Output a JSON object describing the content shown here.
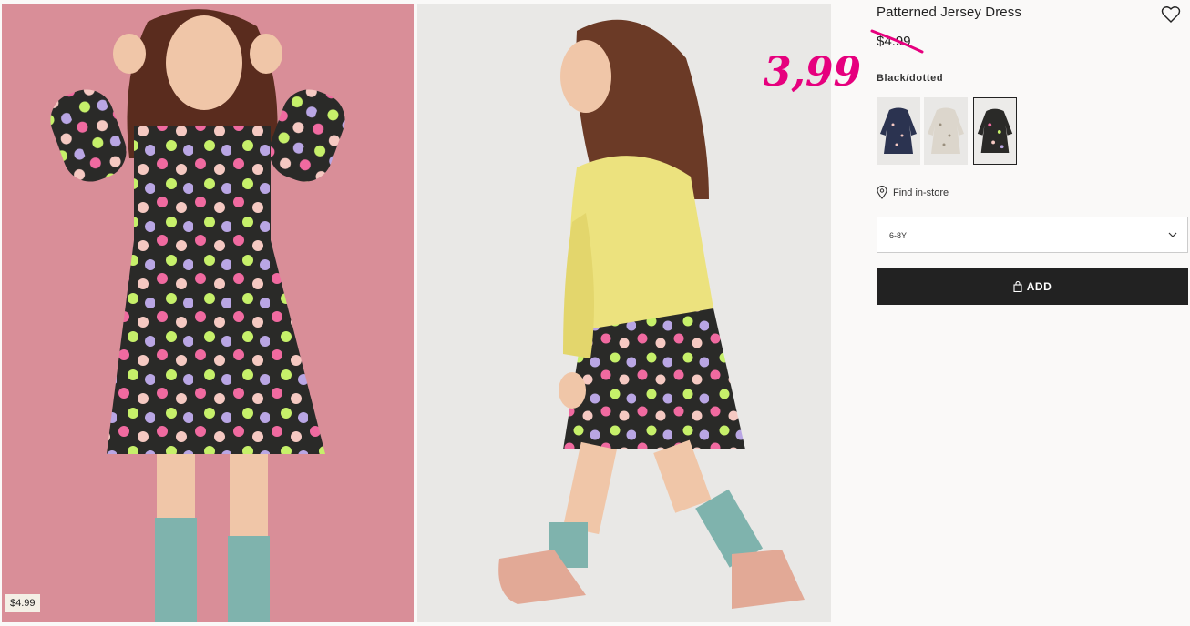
{
  "product": {
    "title": "Patterned Jersey Dress",
    "old_price": "$4.99",
    "new_price": "3,99",
    "color_label": "Black/dotted"
  },
  "gallery": {
    "price_tag": "$4.99"
  },
  "swatches": [
    {
      "name": "dark-blue-patterned",
      "selected": false
    },
    {
      "name": "light-beige-patterned",
      "selected": false
    },
    {
      "name": "black-dotted",
      "selected": true
    }
  ],
  "store": {
    "find_label": "Find in-store"
  },
  "size": {
    "selected": "6-8Y"
  },
  "cart": {
    "add_label": "ADD"
  },
  "colors": {
    "accent_price": "#e6007e",
    "button_bg": "#222222",
    "photo1_bg": "#d98e98",
    "photo2_bg": "#e9e8e6"
  },
  "icons": [
    "heart-icon",
    "location-pin-icon",
    "chevron-down-icon",
    "bag-icon"
  ]
}
